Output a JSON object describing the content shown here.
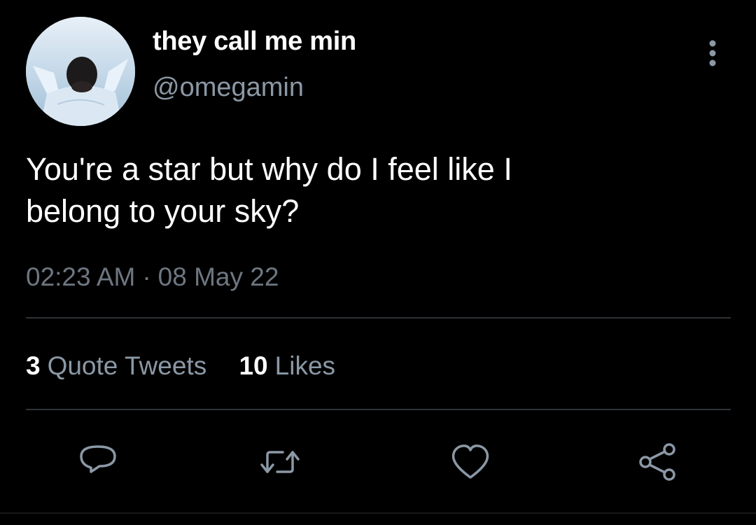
{
  "user": {
    "display_name": "they call me min",
    "handle": "@omegamin",
    "avatar": "profile-photo"
  },
  "tweet": {
    "text_line1": "You're a star but why do I feel like I",
    "text_line2": "belong to your sky?",
    "time": "02:23 AM",
    "separator": "·",
    "date": "08 May 22"
  },
  "stats": {
    "quote_count": "3",
    "quote_label": "Quote Tweets",
    "like_count": "10",
    "like_label": "Likes"
  },
  "actions": {
    "reply_icon": "reply-icon",
    "retweet_icon": "retweet-icon",
    "like_icon": "heart-icon",
    "share_icon": "share-icon",
    "more_icon": "more-vertical-icon"
  },
  "colors": {
    "background": "#000000",
    "primary_text": "#ffffff",
    "secondary_text": "#8b98a5",
    "muted_text": "#6e7781",
    "divider": "#2f3336",
    "icon": "#8b98a5"
  }
}
